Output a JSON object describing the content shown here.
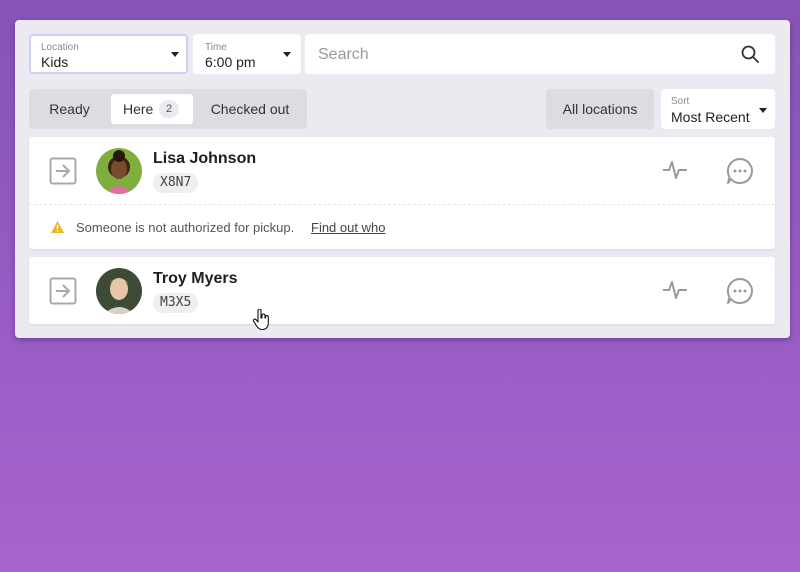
{
  "filters": {
    "location": {
      "label": "Location",
      "value": "Kids"
    },
    "time": {
      "label": "Time",
      "value": "6:00 pm"
    },
    "search": {
      "placeholder": "Search"
    }
  },
  "tabs": [
    {
      "label": "Ready"
    },
    {
      "label": "Here",
      "count": "2",
      "active": true
    },
    {
      "label": "Checked out"
    }
  ],
  "locations_button": {
    "label": "All locations"
  },
  "sort": {
    "label": "Sort",
    "value": "Most Recent"
  },
  "people": [
    {
      "name": "Lisa Johnson",
      "code": "X8N7",
      "alert": {
        "text": "Someone is not authorized for pickup.",
        "link": "Find out who"
      }
    },
    {
      "name": "Troy Myers",
      "code": "M3X5"
    }
  ],
  "colors": {
    "background": "#9a5cc6",
    "panel": "#eceaf0",
    "warning": "#e8b623",
    "icon_gray": "#9a9a9a",
    "focus_border": "#c9d3ef"
  }
}
